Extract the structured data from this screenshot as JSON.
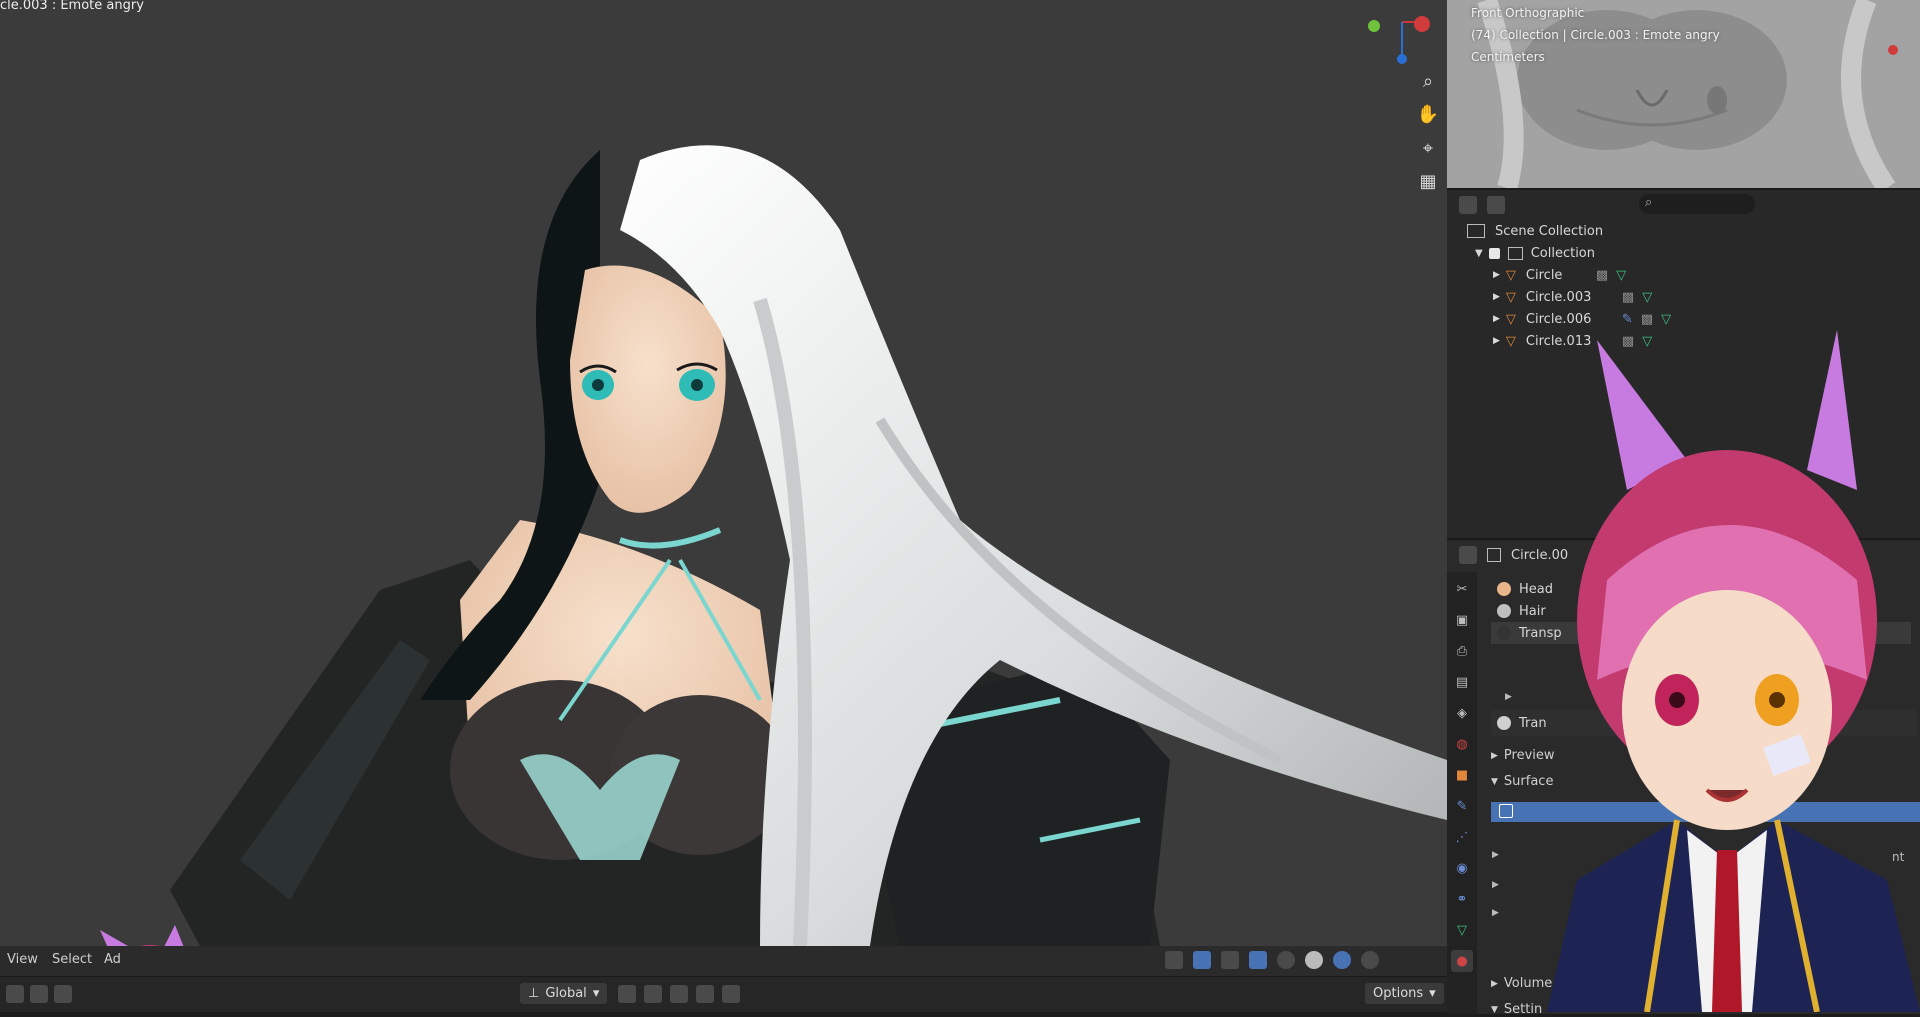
{
  "viewport": {
    "title": "cle.003 : Emote angry",
    "menus": [
      "View",
      "Select",
      "Ad"
    ],
    "transform_orientation": "Global",
    "options_label": "Options"
  },
  "mini_viewport": {
    "line1": "Front Orthographic",
    "line2": "(74) Collection | Circle.003 : Emote angry",
    "line3": "Centimeters"
  },
  "outliner": {
    "scene_collection": "Scene Collection",
    "collection": "Collection",
    "objects": [
      "Circle",
      "Circle.003",
      "Circle.006",
      "Circle.013"
    ]
  },
  "properties": {
    "object_name": "Circle.00",
    "materials": [
      "Head",
      "Hair",
      "Transp"
    ],
    "material_slot_name": "Tran",
    "sections": [
      "Preview",
      "Surface",
      "Volume",
      "Settin"
    ],
    "partial_label": "nt"
  },
  "colors": {
    "accent": "#4772b3",
    "viewport_bg": "#3b3b3b",
    "object_icon": "#e0873a",
    "mesh_icon": "#3fbf7f"
  }
}
